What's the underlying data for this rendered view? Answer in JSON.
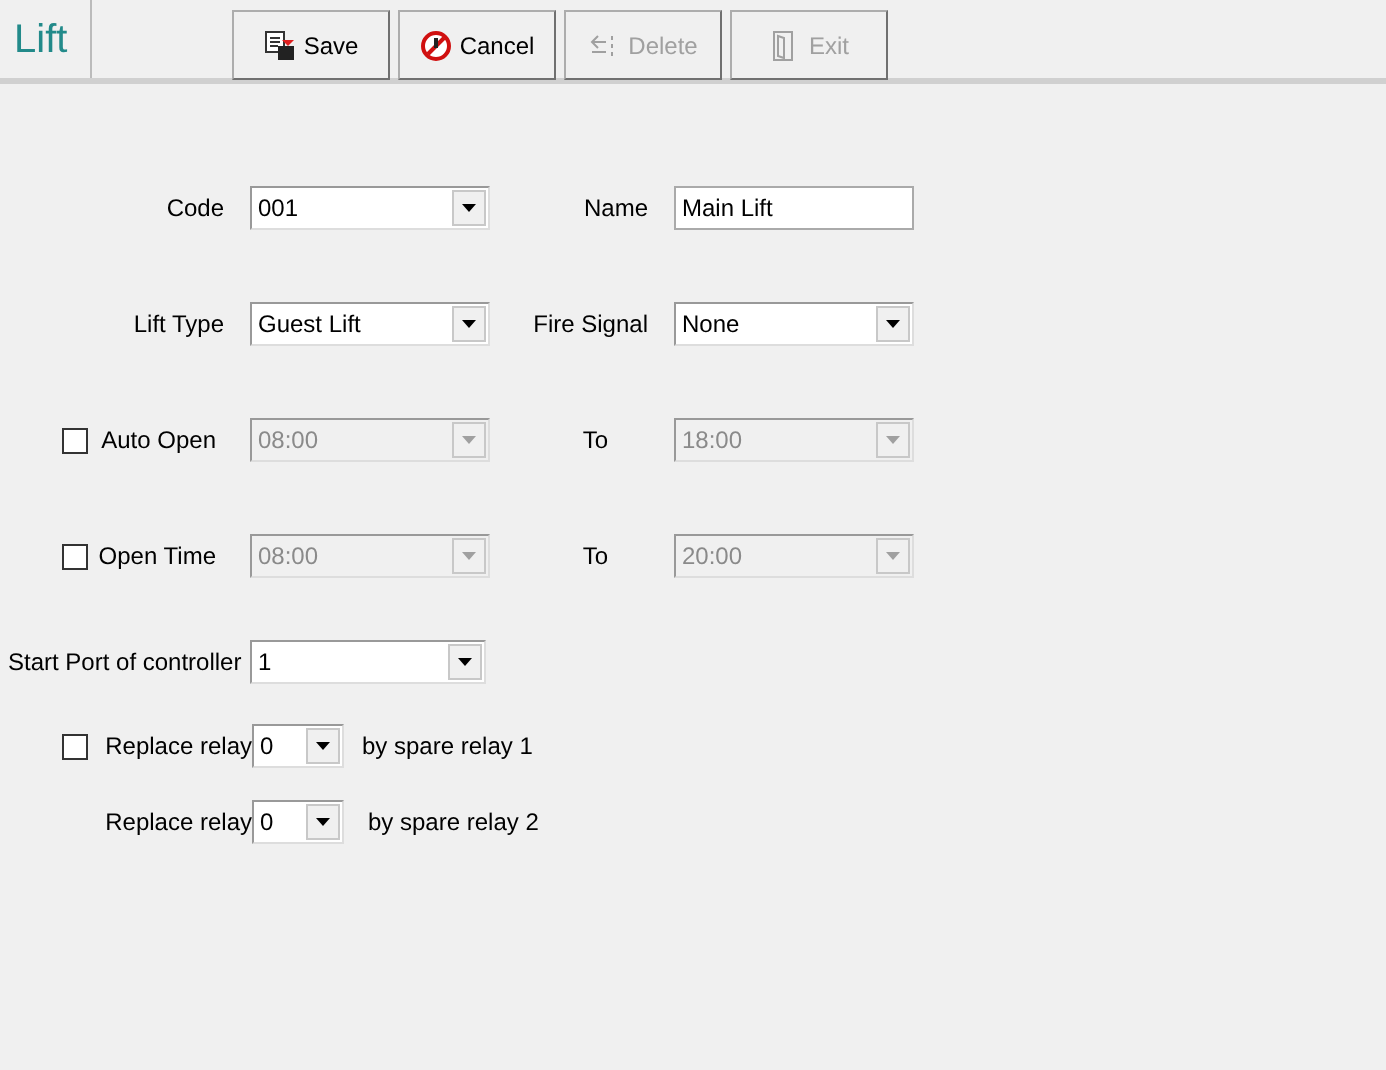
{
  "header": {
    "title": "Lift"
  },
  "toolbar": [
    {
      "kind": "save",
      "label": "Save",
      "disabled": false
    },
    {
      "kind": "cancel",
      "label": "Cancel",
      "disabled": false
    },
    {
      "kind": "delete",
      "label": "Delete",
      "disabled": true
    },
    {
      "kind": "exit",
      "label": "Exit",
      "disabled": true
    }
  ],
  "rows": [
    {
      "left": {
        "label": "Code",
        "value": "001",
        "kind": "select",
        "disabled": false
      },
      "right": {
        "label": "Name",
        "value": "Main Lift",
        "kind": "text",
        "disabled": false
      }
    },
    {
      "left": {
        "label": "Lift Type",
        "value": "Guest Lift",
        "kind": "select",
        "disabled": false
      },
      "right": {
        "label": "Fire Signal",
        "value": "None",
        "kind": "select",
        "disabled": false
      }
    },
    {
      "checked": false,
      "left": {
        "label": "Auto Open",
        "value": "08:00",
        "kind": "select",
        "disabled": true
      },
      "right": {
        "label": "To",
        "value": "18:00",
        "kind": "select",
        "disabled": true
      }
    },
    {
      "checked": false,
      "left": {
        "label": "Open Time",
        "value": "08:00",
        "kind": "select",
        "disabled": true
      },
      "right": {
        "label": "To",
        "value": "20:00",
        "kind": "select",
        "disabled": true
      }
    }
  ],
  "start_port": {
    "label": "Start Port of controller",
    "value": "1"
  },
  "relays": [
    {
      "checked": false,
      "label": "Replace relay",
      "value": "0",
      "suffix": "by spare relay 1"
    },
    {
      "label": "Replace relay",
      "value": "0",
      "suffix": "by spare relay 2"
    }
  ]
}
